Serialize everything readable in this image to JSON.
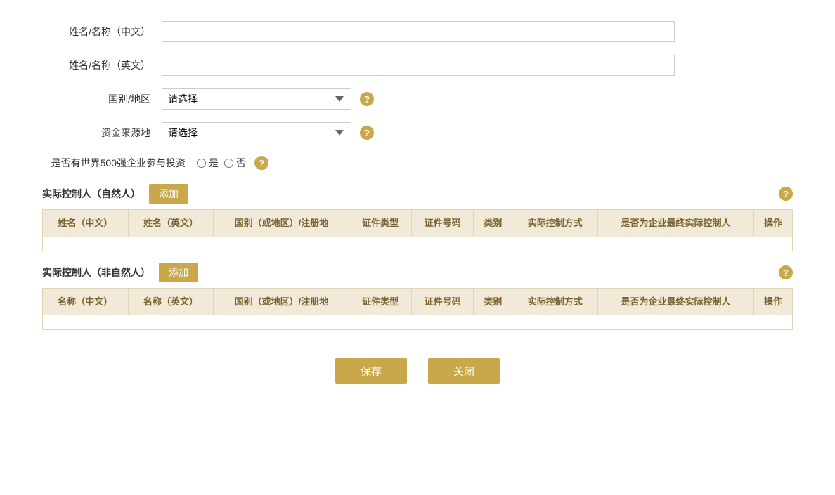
{
  "form": {
    "name_cn_label": "姓名/名称（中文）",
    "name_en_label": "姓名/名称（英文）",
    "country_label": "国别/地区",
    "fund_source_label": "资金来源地",
    "fortune500_label": "是否有世界500强企业参与投资",
    "country_placeholder": "请选择",
    "fund_source_placeholder": "请选择",
    "radio_yes": "是",
    "radio_no": "否"
  },
  "section1": {
    "title": "实际控制人（自然人）",
    "add_label": "添加",
    "columns": [
      "姓名（中文）",
      "姓名（英文）",
      "国别（或地区）/注册地",
      "证件类型",
      "证件号码",
      "类别",
      "实际控制方式",
      "是否为企业最终实际控制人",
      "操作"
    ]
  },
  "section2": {
    "title": "实际控制人（非自然人）",
    "add_label": "添加",
    "columns": [
      "名称（中文）",
      "名称（英文）",
      "国别（或地区）/注册地",
      "证件类型",
      "证件号码",
      "类别",
      "实际控制方式",
      "是否为企业最终实际控制人",
      "操作"
    ]
  },
  "buttons": {
    "save": "保存",
    "close": "关闭"
  },
  "help_icon": "?",
  "colors": {
    "gold": "#c8a84b",
    "table_header_bg": "#f2ead8",
    "table_header_text": "#7a6230"
  }
}
